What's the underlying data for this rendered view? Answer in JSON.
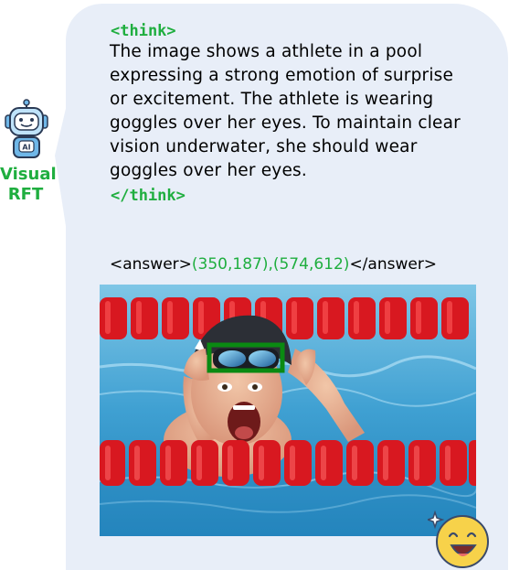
{
  "agent": {
    "label_line1": "Visual",
    "label_line2": "RFT",
    "avatar_icon": "robot-ai-icon",
    "avatar_badge": "AI"
  },
  "response": {
    "think_open": "<think>",
    "reasoning": "The image shows a athlete in a pool expressing a strong emotion of surprise or excitement. The athlete is wearing goggles over her eyes. To maintain clear vision underwater, she should wear goggles over her eyes.",
    "think_close": "</think>",
    "answer_open": "<answer>",
    "answer_coords": "(350,187),(574,612)",
    "answer_close": "</answer>"
  },
  "photo": {
    "subject": "swimmer-in-pool-image",
    "highlight_box_color": "#0a8a12"
  },
  "decoration": {
    "emoji_icon": "starstruck-emoji-icon"
  },
  "colors": {
    "accent_green": "#1fae3f",
    "bubble_bg": "#e8eef8"
  }
}
